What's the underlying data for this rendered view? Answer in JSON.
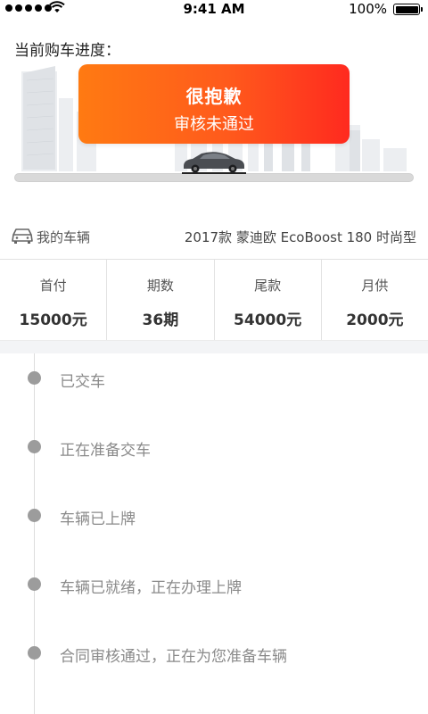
{
  "status_bar": {
    "time": "9:41 AM",
    "battery": "100%",
    "icons": [
      "signal-dots-icon",
      "wifi-icon",
      "battery-icon"
    ]
  },
  "progress": {
    "title": "当前购车进度：",
    "status_main": "很抱歉",
    "status_sub": "审核未通过",
    "accent_colors": [
      "#ff7a12",
      "#ff2a1f"
    ]
  },
  "vehicle": {
    "icon": "car-icon",
    "label": "我的车辆",
    "model": "2017款 蒙迪欧 EcoBoost 180 时尚型"
  },
  "terms": [
    {
      "label": "首付",
      "value": "15000元"
    },
    {
      "label": "期数",
      "value": "36期"
    },
    {
      "label": "尾款",
      "value": "54000元"
    },
    {
      "label": "月供",
      "value": "2000元"
    }
  ],
  "timeline": [
    {
      "text": "已交车"
    },
    {
      "text": "正在准备交车"
    },
    {
      "text": "车辆已上牌"
    },
    {
      "text": "车辆已就绪，正在办理上牌"
    },
    {
      "text": "合同审核通过，正在为您准备车辆"
    }
  ]
}
